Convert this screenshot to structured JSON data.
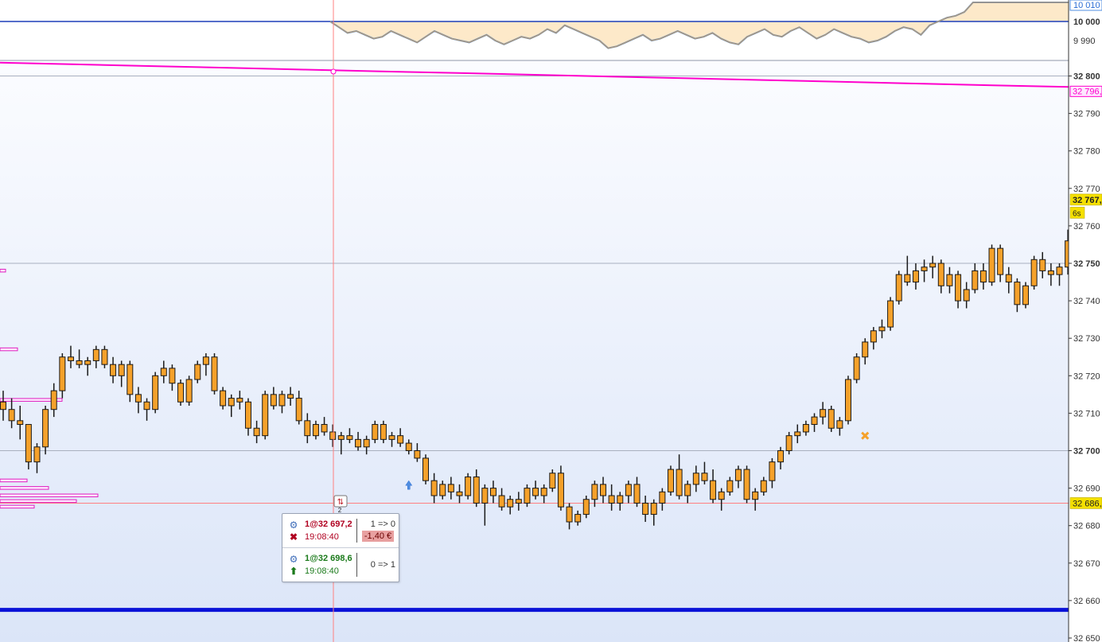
{
  "chart_data": {
    "type": "candlestick",
    "y_axis": {
      "ylim": [
        32650,
        32814
      ],
      "tick_labels": [
        "32 800",
        "32 790",
        "32 780",
        "32 770",
        "32 760",
        "32 750",
        "32 740",
        "32 730",
        "32 720",
        "32 710",
        "32 700",
        "32 690",
        "32 680",
        "32 670",
        "32 660",
        "32 650"
      ],
      "tick_values": [
        32800,
        32790,
        32780,
        32770,
        32760,
        32750,
        32740,
        32730,
        32720,
        32710,
        32700,
        32690,
        32680,
        32670,
        32660,
        32650
      ]
    },
    "price_markers": [
      {
        "label": "32 767,",
        "value": 32767,
        "style": "current-price",
        "color": "#f5e000"
      },
      {
        "label": "6s",
        "value": 32763.5,
        "style": "timer",
        "color": "#f5e000"
      },
      {
        "label": "32 796,",
        "value": 32796,
        "style": "ma-value",
        "color": "#ff00cc"
      },
      {
        "label": "32 686,",
        "value": 32686,
        "style": "crosshair",
        "color": "#f5e000"
      }
    ],
    "horizontal_lines": [
      {
        "value": 32750,
        "color": "#a9b0bf"
      },
      {
        "value": 32700,
        "color": "#a9b0bf"
      },
      {
        "value": 32800,
        "color": "#a9b0bf"
      },
      {
        "value": 32686,
        "color": "#ff8080"
      },
      {
        "value": 32657.5,
        "color": "#0a12d8",
        "thick": true
      }
    ],
    "moving_average": {
      "color": "#ff00cc",
      "value_start": 32802.5,
      "value_end": 32796
    },
    "candles": [
      [
        32713,
        32716,
        32708,
        32711
      ],
      [
        32711,
        32714,
        32706,
        32708
      ],
      [
        32708,
        32712,
        32703,
        32707
      ],
      [
        32707,
        32707,
        32695,
        32697
      ],
      [
        32697,
        32702,
        32694,
        32701
      ],
      [
        32701,
        32712,
        32699,
        32711
      ],
      [
        32711,
        32718,
        32709,
        32716
      ],
      [
        32716,
        32726,
        32714,
        32725
      ],
      [
        32725,
        32728,
        32722,
        32724
      ],
      [
        32724,
        32727,
        32722,
        32723
      ],
      [
        32723,
        32725,
        32720,
        32724
      ],
      [
        32724,
        32728,
        32722,
        32727
      ],
      [
        32727,
        32728,
        32722,
        32723
      ],
      [
        32723,
        32725,
        32718,
        32720
      ],
      [
        32720,
        32724,
        32717,
        32723
      ],
      [
        32723,
        32724,
        32713,
        32715
      ],
      [
        32715,
        32717,
        32710,
        32713
      ],
      [
        32713,
        32714,
        32708,
        32711
      ],
      [
        32711,
        32721,
        32710,
        32720
      ],
      [
        32720,
        32724,
        32718,
        32722
      ],
      [
        32722,
        32723,
        32716,
        32718
      ],
      [
        32718,
        32719,
        32712,
        32713
      ],
      [
        32713,
        32720,
        32712,
        32719
      ],
      [
        32719,
        32724,
        32718,
        32723
      ],
      [
        32723,
        32726,
        32720,
        32725
      ],
      [
        32725,
        32726,
        32715,
        32716
      ],
      [
        32716,
        32717,
        32711,
        32712
      ],
      [
        32712,
        32715,
        32709,
        32714
      ],
      [
        32714,
        32716,
        32711,
        32713
      ],
      [
        32713,
        32714,
        32704,
        32706
      ],
      [
        32706,
        32708,
        32702,
        32704
      ],
      [
        32704,
        32716,
        32703,
        32715
      ],
      [
        32715,
        32717,
        32711,
        32712
      ],
      [
        32712,
        32716,
        32710,
        32715
      ],
      [
        32715,
        32717,
        32712,
        32714
      ],
      [
        32714,
        32716,
        32707,
        32708
      ],
      [
        32708,
        32710,
        32702,
        32704
      ],
      [
        32704,
        32708,
        32703,
        32707
      ],
      [
        32707,
        32709,
        32704,
        32705
      ],
      [
        32705,
        32707,
        32701,
        32703
      ],
      [
        32703,
        32705,
        32699,
        32704
      ],
      [
        32704,
        32706,
        32702,
        32703
      ],
      [
        32703,
        32705,
        32700,
        32701
      ],
      [
        32701,
        32704,
        32699,
        32703
      ],
      [
        32703,
        32708,
        32702,
        32707
      ],
      [
        32707,
        32708,
        32702,
        32703
      ],
      [
        32703,
        32705,
        32701,
        32704
      ],
      [
        32704,
        32706,
        32701,
        32702
      ],
      [
        32702,
        32703,
        32699,
        32700
      ],
      [
        32700,
        32702,
        32697,
        32698
      ],
      [
        32698,
        32699,
        32691,
        32692
      ],
      [
        32692,
        32694,
        32686,
        32688
      ],
      [
        32688,
        32692,
        32687,
        32691
      ],
      [
        32691,
        32693,
        32687,
        32689
      ],
      [
        32689,
        32691,
        32686,
        32688
      ],
      [
        32688,
        32694,
        32687,
        32693
      ],
      [
        32693,
        32695,
        32685,
        32686
      ],
      [
        32686,
        32691,
        32680,
        32690
      ],
      [
        32690,
        32692,
        32686,
        32688
      ],
      [
        32688,
        32690,
        32684,
        32685
      ],
      [
        32685,
        32688,
        32683,
        32687
      ],
      [
        32687,
        32689,
        32684,
        32686
      ],
      [
        32686,
        32691,
        32685,
        32690
      ],
      [
        32690,
        32692,
        32687,
        32688
      ],
      [
        32688,
        32691,
        32686,
        32690
      ],
      [
        32690,
        32695,
        32689,
        32694
      ],
      [
        32694,
        32696,
        32684,
        32685
      ],
      [
        32685,
        32686,
        32679,
        32681
      ],
      [
        32681,
        32684,
        32680,
        32683
      ],
      [
        32683,
        32688,
        32682,
        32687
      ],
      [
        32687,
        32692,
        32685,
        32691
      ],
      [
        32691,
        32693,
        32686,
        32688
      ],
      [
        32688,
        32691,
        32684,
        32686
      ],
      [
        32686,
        32689,
        32684,
        32688
      ],
      [
        32688,
        32692,
        32686,
        32691
      ],
      [
        32691,
        32693,
        32685,
        32686
      ],
      [
        32686,
        32688,
        32681,
        32683
      ],
      [
        32683,
        32687,
        32680,
        32686
      ],
      [
        32686,
        32690,
        32684,
        32689
      ],
      [
        32689,
        32696,
        32688,
        32695
      ],
      [
        32695,
        32699,
        32687,
        32688
      ],
      [
        32688,
        32692,
        32686,
        32691
      ],
      [
        32691,
        32696,
        32689,
        32694
      ],
      [
        32694,
        32697,
        32691,
        32692
      ],
      [
        32692,
        32695,
        32686,
        32687
      ],
      [
        32687,
        32690,
        32684,
        32689
      ],
      [
        32689,
        32693,
        32688,
        32692
      ],
      [
        32692,
        32696,
        32690,
        32695
      ],
      [
        32695,
        32696,
        32686,
        32687
      ],
      [
        32687,
        32690,
        32684,
        32689
      ],
      [
        32689,
        32693,
        32688,
        32692
      ],
      [
        32692,
        32698,
        32690,
        32697
      ],
      [
        32697,
        32701,
        32695,
        32700
      ],
      [
        32700,
        32705,
        32699,
        32704
      ],
      [
        32704,
        32707,
        32702,
        32705
      ],
      [
        32705,
        32708,
        32704,
        32707
      ],
      [
        32707,
        32710,
        32705,
        32709
      ],
      [
        32709,
        32713,
        32707,
        32711
      ],
      [
        32711,
        32712,
        32705,
        32706
      ],
      [
        32706,
        32709,
        32704,
        32708
      ],
      [
        32708,
        32720,
        32707,
        32719
      ],
      [
        32719,
        32726,
        32718,
        32725
      ],
      [
        32725,
        32730,
        32723,
        32729
      ],
      [
        32729,
        32733,
        32727,
        32732
      ],
      [
        32732,
        32735,
        32730,
        32733
      ],
      [
        32733,
        32741,
        32732,
        32740
      ],
      [
        32740,
        32748,
        32739,
        32747
      ],
      [
        32747,
        32752,
        32744,
        32745
      ],
      [
        32745,
        32750,
        32743,
        32748
      ],
      [
        32748,
        32751,
        32745,
        32749
      ],
      [
        32749,
        32752,
        32746,
        32750
      ],
      [
        32750,
        32751,
        32742,
        32744
      ],
      [
        32744,
        32749,
        32742,
        32747
      ],
      [
        32747,
        32748,
        32738,
        32740
      ],
      [
        32740,
        32745,
        32738,
        32743
      ],
      [
        32743,
        32750,
        32742,
        32748
      ],
      [
        32748,
        32750,
        32743,
        32745
      ],
      [
        32745,
        32755,
        32744,
        32754
      ],
      [
        32754,
        32755,
        32745,
        32747
      ],
      [
        32747,
        32749,
        32742,
        32745
      ],
      [
        32745,
        32746,
        32737,
        32739
      ],
      [
        32739,
        32745,
        32738,
        32744
      ],
      [
        32744,
        32752,
        32743,
        32751
      ],
      [
        32751,
        32753,
        32746,
        32748
      ],
      [
        32748,
        32750,
        32744,
        32747
      ],
      [
        32747,
        32750,
        32744,
        32749
      ],
      [
        32749,
        32759,
        32747,
        32756
      ],
      [
        32756,
        32757,
        32754,
        32755
      ]
    ],
    "volume_profile_left": [
      {
        "price": 32748,
        "len": 7
      },
      {
        "price": 32727,
        "len": 22
      },
      {
        "price": 32713.5,
        "len": 78
      },
      {
        "price": 32692,
        "len": 34
      },
      {
        "price": 32690,
        "len": 61
      },
      {
        "price": 32688,
        "len": 123
      },
      {
        "price": 32686.5,
        "len": 96
      },
      {
        "price": 32685,
        "len": 43
      }
    ],
    "markers": [
      {
        "type": "entry-arrow",
        "candle_index": 48,
        "price": 32692
      },
      {
        "type": "exit-cross",
        "candle_index": 102,
        "price": 32704
      }
    ],
    "top_indicator": {
      "tick_labels": [
        "10 010",
        "10 000",
        "9 990"
      ],
      "tick_values": [
        10010,
        10000,
        9990
      ],
      "zero_value": 10000,
      "ylim": [
        9985,
        10012
      ],
      "series": [
        10000,
        9997,
        9994,
        9995,
        9993,
        9991,
        9992,
        9995,
        9993,
        9991,
        9989,
        9992,
        9995,
        9993,
        9991,
        9990,
        9989,
        9991,
        9993,
        9990,
        9988,
        9990,
        9992,
        9991,
        9993,
        9996,
        9994,
        9998,
        9996,
        9994,
        9992,
        9990,
        9986,
        9987,
        9989,
        9991,
        9993,
        9990,
        9991,
        9993,
        9995,
        9993,
        9991,
        9992,
        9994,
        9991,
        9989,
        9988,
        9992,
        9994,
        9996,
        9993,
        9992,
        9995,
        9997,
        9994,
        9991,
        9993,
        9996,
        9994,
        9992,
        9991,
        9989,
        9990,
        9992,
        9995,
        9997,
        9996,
        9993,
        9998,
        10000,
        10002,
        10003,
        10005,
        10010,
        10010,
        10010,
        10010,
        10010,
        10010,
        10010,
        10010,
        10010,
        10010,
        10010,
        10010
      ],
      "color_fill": "#fde9c9",
      "color_line": "#4f8de0"
    },
    "title": "",
    "xlabel": "",
    "ylabel": ""
  },
  "trades": [
    {
      "price_text": "1@32 697,2",
      "time": "19:08:40",
      "position": "1 => 0",
      "pnl": "-1,40 €",
      "icon": "close-cross-icon",
      "color": "red"
    },
    {
      "price_text": "1@32 698,6",
      "time": "19:08:40",
      "position": "0 => 1",
      "icon": "buy-arrow-icon",
      "color": "green"
    }
  ],
  "trade_badge": {
    "icon": "trade-swap-icon",
    "count": "2"
  },
  "colors": {
    "candle_fill": "#f5a12a",
    "candle_border": "#1a1a1a",
    "background_top": "#fafcff",
    "background_bottom": "#dfe8fa",
    "crosshair": "#ff8080"
  }
}
